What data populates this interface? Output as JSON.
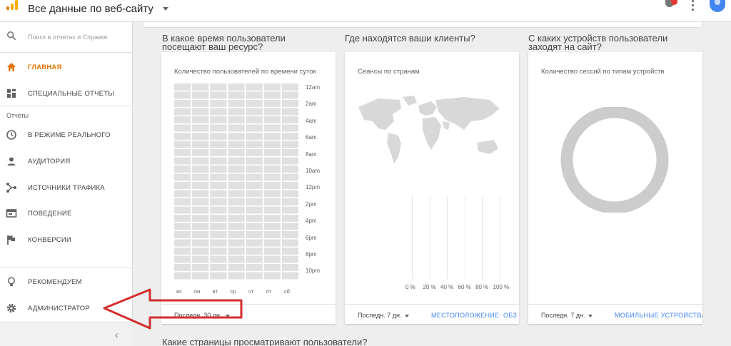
{
  "header": {
    "account_title": "Все данные по веб-сайту",
    "icons": [
      "analytics-logo",
      "notifications-icon",
      "more-vert-icon",
      "account-avatar"
    ],
    "brand_colors": {
      "orange": "#e37400",
      "yellow": "#f9ab00",
      "blue": "#4285f4"
    }
  },
  "sidebar": {
    "search_placeholder": "Поиск в отчетах и Справке",
    "items_top": [
      {
        "label": "ГЛАВНАЯ",
        "icon": "home-icon",
        "active": true
      },
      {
        "label": "СПЕЦИАЛЬНЫЕ ОТЧЕТЫ",
        "icon": "dashboard-icon",
        "active": false
      }
    ],
    "reports_label": "Отчеты",
    "items_reports": [
      {
        "label": "В РЕЖИМЕ РЕАЛЬНОГО",
        "icon": "clock-icon"
      },
      {
        "label": "АУДИТОРИЯ",
        "icon": "person-icon"
      },
      {
        "label": "ИСТОЧНИКИ ТРАФИКА",
        "icon": "acquisition-icon"
      },
      {
        "label": "ПОВЕДЕНИЕ",
        "icon": "behavior-icon"
      },
      {
        "label": "КОНВЕРСИИ",
        "icon": "flag-icon"
      }
    ],
    "items_bottom": [
      {
        "label": "РЕКОМЕНДУЕМ",
        "icon": "lightbulb-icon"
      },
      {
        "label": "АДМИНИСТРАТОР",
        "icon": "gear-icon"
      }
    ],
    "collapse_glyph": "‹"
  },
  "main": {
    "cards": [
      {
        "question": [
          "В какое время пользователи",
          "посещают ваш ресурс?"
        ],
        "title": "Количество пользователей по времени суток",
        "range": "Последн. 30 дн.",
        "report_link": ""
      },
      {
        "question": [
          "Где находятся ваши клиенты?"
        ],
        "title": "Сеансы по странам",
        "range": "Последн. 7 дн.",
        "report_link": "МЕСТОПОЛОЖЕНИЕ: ОБЗОР"
      },
      {
        "question": [
          "С каких устройств пользователи",
          "заходят на сайт?"
        ],
        "title": "Количество сессий по типам устройств",
        "range": "Последн. 7 дн.",
        "report_link": "МОБИЛЬНЫЕ УСТРОЙСТВА"
      }
    ],
    "bottom_question": "Какие страницы просматривают пользователи?",
    "heatmap": {
      "hours": [
        "12am",
        "2am",
        "4am",
        "6am",
        "8am",
        "10am",
        "12pm",
        "2pm",
        "4pm",
        "6pm",
        "8pm",
        "10pm"
      ],
      "days": [
        "вс",
        "пн",
        "вт",
        "ср",
        "чт",
        "пт",
        "сб"
      ],
      "rows": 24,
      "cell_color": "#e0e0e0"
    },
    "country_percent_ticks": [
      "0 %",
      "20 %",
      "40 %",
      "60 %",
      "80 %",
      "100 %"
    ],
    "device_ring_color": "#cccccc",
    "annotation_arrow_color": "#d32f2f"
  }
}
